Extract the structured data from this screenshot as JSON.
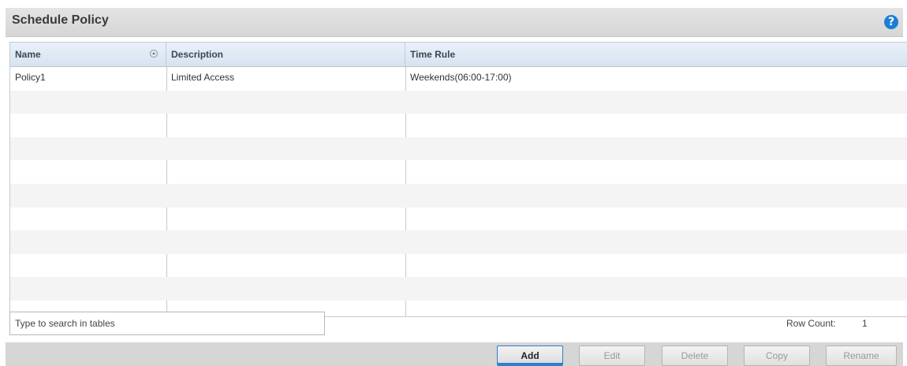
{
  "panel": {
    "title": "Schedule Policy"
  },
  "table": {
    "columns": [
      "Name",
      "Description",
      "Time Rule"
    ],
    "rows": [
      {
        "name": "Policy1",
        "description": "Limited Access",
        "time_rule": "Weekends(06:00-17:00)"
      }
    ]
  },
  "search": {
    "placeholder": "Type to search in tables"
  },
  "row_count": {
    "label": "Row Count:",
    "value": "1"
  },
  "buttons": {
    "add": "Add",
    "edit": "Edit",
    "delete": "Delete",
    "copy": "Copy",
    "rename": "Rename"
  },
  "icons": {
    "help": "help-icon",
    "sort": "sort-ascending-icon"
  },
  "colors": {
    "accent": "#1a7fd4",
    "primary_border": "#2f7fd0"
  }
}
